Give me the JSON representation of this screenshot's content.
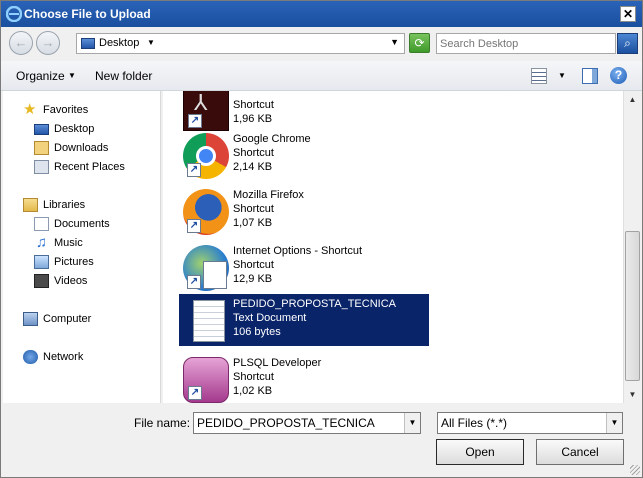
{
  "window": {
    "title": "Choose File to Upload"
  },
  "address": {
    "location": "Desktop",
    "search_placeholder": "Search Desktop"
  },
  "toolbar": {
    "organize": "Organize",
    "new_folder": "New folder"
  },
  "nav": {
    "favorites": "Favorites",
    "desktop": "Desktop",
    "downloads": "Downloads",
    "recent": "Recent Places",
    "libraries": "Libraries",
    "documents": "Documents",
    "music": "Music",
    "pictures": "Pictures",
    "videos": "Videos",
    "computer": "Computer",
    "network": "Network"
  },
  "files": [
    {
      "name": "",
      "type": "Shortcut",
      "size": "1,96 KB",
      "icon": "pdf-icon"
    },
    {
      "name": "Google Chrome",
      "type": "Shortcut",
      "size": "2,14 KB",
      "icon": "chrome-icon"
    },
    {
      "name": "Mozilla Firefox",
      "type": "Shortcut",
      "size": "1,07 KB",
      "icon": "firefox-icon"
    },
    {
      "name": "Internet Options - Shortcut",
      "type": "Shortcut",
      "size": "12,9 KB",
      "icon": "internet-options-icon"
    },
    {
      "name": "PEDIDO_PROPOSTA_TECNICA",
      "type": "Text Document",
      "size": "106 bytes",
      "icon": "text-document-icon",
      "selected": true
    },
    {
      "name": "PLSQL Developer",
      "type": "Shortcut",
      "size": "1,02 KB",
      "icon": "plsql-icon"
    }
  ],
  "bottom": {
    "file_name_label": "File name:",
    "file_name_value": "PEDIDO_PROPOSTA_TECNICA",
    "file_type": "All Files (*.*)",
    "open_label": "Open",
    "cancel_label": "Cancel"
  }
}
